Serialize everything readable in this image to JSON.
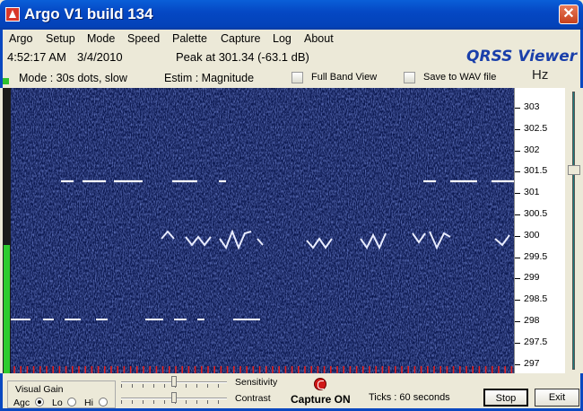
{
  "window": {
    "title": "Argo V1 build 134",
    "close": "✕"
  },
  "menu": [
    "Argo",
    "Setup",
    "Mode",
    "Speed",
    "Palette",
    "Capture",
    "Log",
    "About"
  ],
  "status": {
    "time": "4:52:17 AM",
    "date": "3/4/2010",
    "peak": "Peak at  301.34  (-63.1 dB)",
    "brand": "QRSS Viewer"
  },
  "info": {
    "mode": "Mode : 30s dots, slow",
    "estim": "Estim : Magnitude",
    "full_band": "Full Band View",
    "save_wav": "Save to WAV file",
    "unit": "Hz"
  },
  "scale": {
    "ticks": [
      "303",
      "302.5",
      "302",
      "301.5",
      "301",
      "300.5",
      "300",
      "299.5",
      "299",
      "298.5",
      "298",
      "297.5",
      "297"
    ]
  },
  "controls": {
    "gain_title": "Visual Gain",
    "agc": "Agc",
    "lo": "Lo",
    "hi": "Hi",
    "sensitivity": "Sensitivity",
    "contrast": "Contrast",
    "capture": "Capture ON",
    "ticks": "Ticks   : 60 seconds",
    "stop": "Stop",
    "exit": "Exit",
    "selected_gain": "Agc",
    "sensitivity_level": 0.5,
    "contrast_level": 0.5
  },
  "input_level": 0.45,
  "colors": {
    "waterfall_bg": "#0c1950",
    "signal": "#ffffff",
    "level_green": "#2ecc2e",
    "tick_red": "#e02020"
  }
}
